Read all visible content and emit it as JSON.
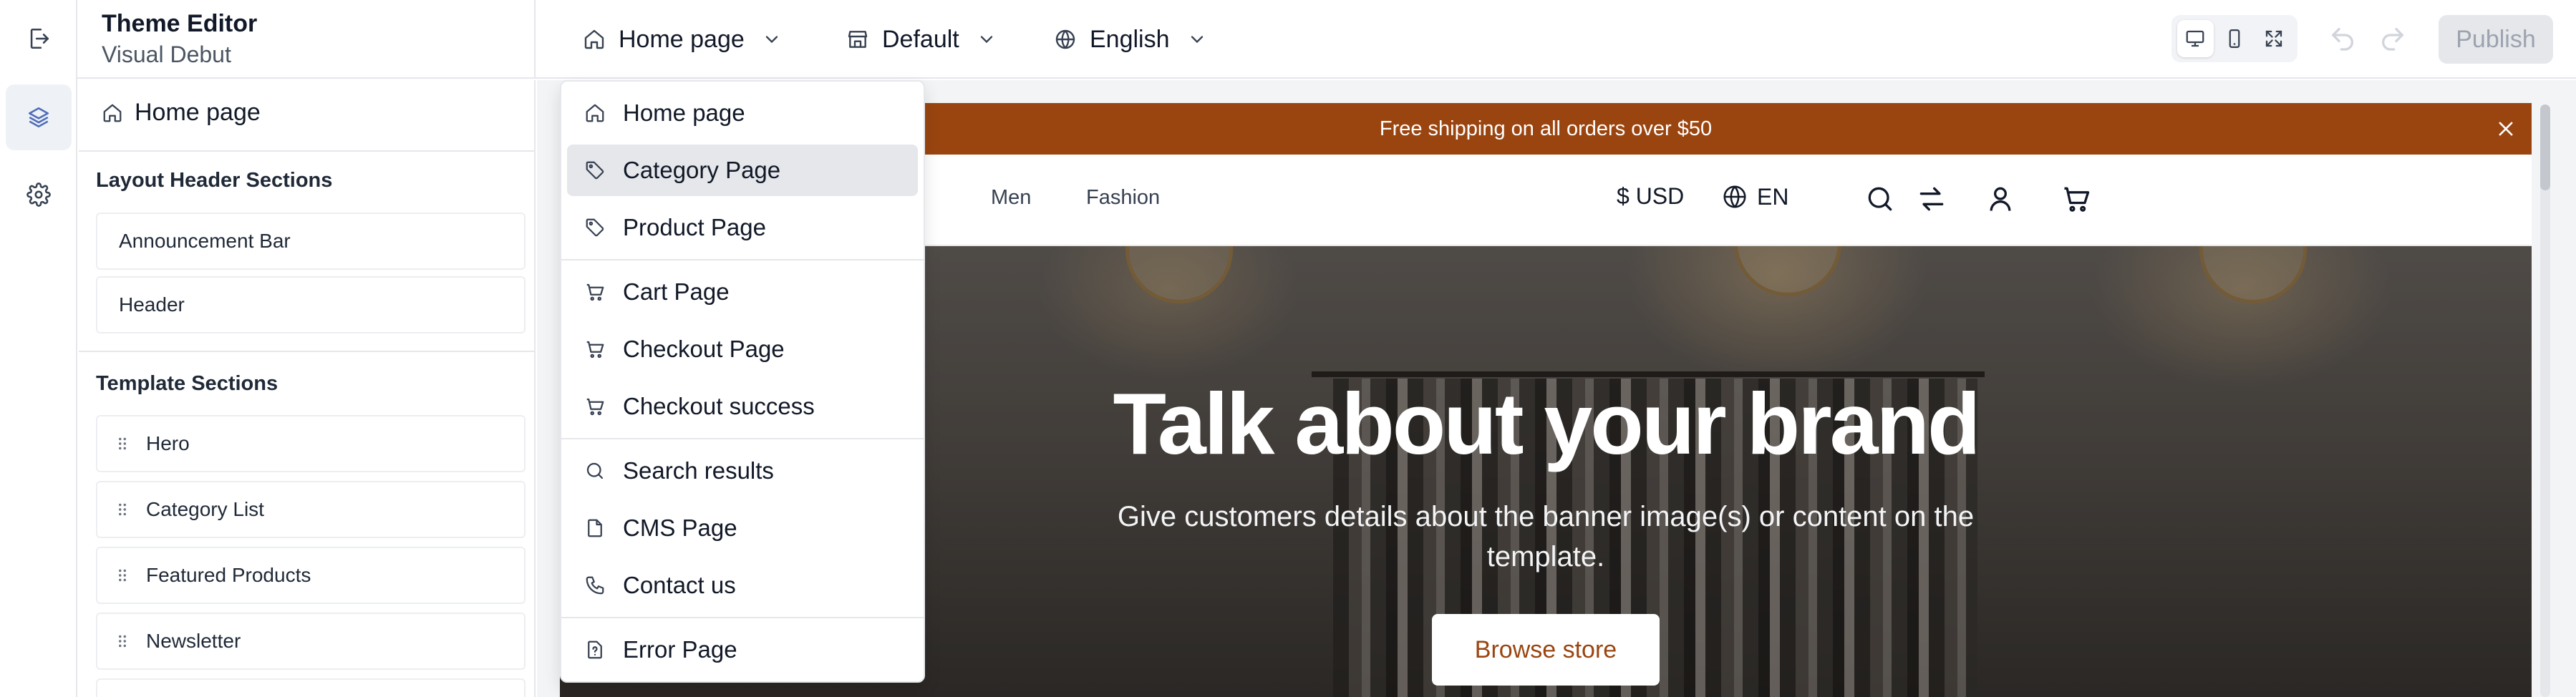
{
  "app": {
    "title": "Theme Editor",
    "subtitle": "Visual Debut"
  },
  "rail": {
    "items": [
      {
        "icon": "exit-icon"
      },
      {
        "icon": "layers-icon",
        "active": true
      },
      {
        "icon": "gear-icon"
      }
    ]
  },
  "toolbar": {
    "page_select": {
      "icon": "home-icon",
      "label": "Home page"
    },
    "theme_select": {
      "icon": "store-icon",
      "label": "Default"
    },
    "language_select": {
      "icon": "globe-icon",
      "label": "English"
    },
    "devices": [
      "desktop",
      "mobile",
      "fullscreen"
    ],
    "active_device": "desktop",
    "publish_label": "Publish"
  },
  "sidebar": {
    "title": "Home page",
    "header_sections_heading": "Layout Header Sections",
    "header_sections": [
      "Announcement Bar",
      "Header"
    ],
    "template_sections_heading": "Template Sections",
    "template_sections": [
      "Hero",
      "Category List",
      "Featured Products",
      "Newsletter"
    ]
  },
  "page_menu": {
    "items": [
      {
        "label": "Home page",
        "icon": "home-icon"
      },
      {
        "label": "Category Page",
        "icon": "tag-icon",
        "active": true
      },
      {
        "label": "Product Page",
        "icon": "tag-icon"
      },
      {
        "label": "Cart Page",
        "icon": "cart-icon"
      },
      {
        "label": "Checkout Page",
        "icon": "cart-icon"
      },
      {
        "label": "Checkout success",
        "icon": "cart-icon"
      },
      {
        "label": "Search results",
        "icon": "search-icon"
      },
      {
        "label": "CMS Page",
        "icon": "file-icon"
      },
      {
        "label": "Contact us",
        "icon": "phone-icon"
      },
      {
        "label": "Error Page",
        "icon": "file-question-icon"
      }
    ]
  },
  "preview": {
    "announcement": "Free shipping on all orders over $50",
    "nav_links": [
      "Men",
      "Fashion"
    ],
    "currency": "$ USD",
    "language": "EN",
    "hero": {
      "title": "Talk about your brand",
      "description": "Give customers details about the banner image(s) or content on the template.",
      "button": "Browse store"
    },
    "accent_color": "#9a4510"
  }
}
